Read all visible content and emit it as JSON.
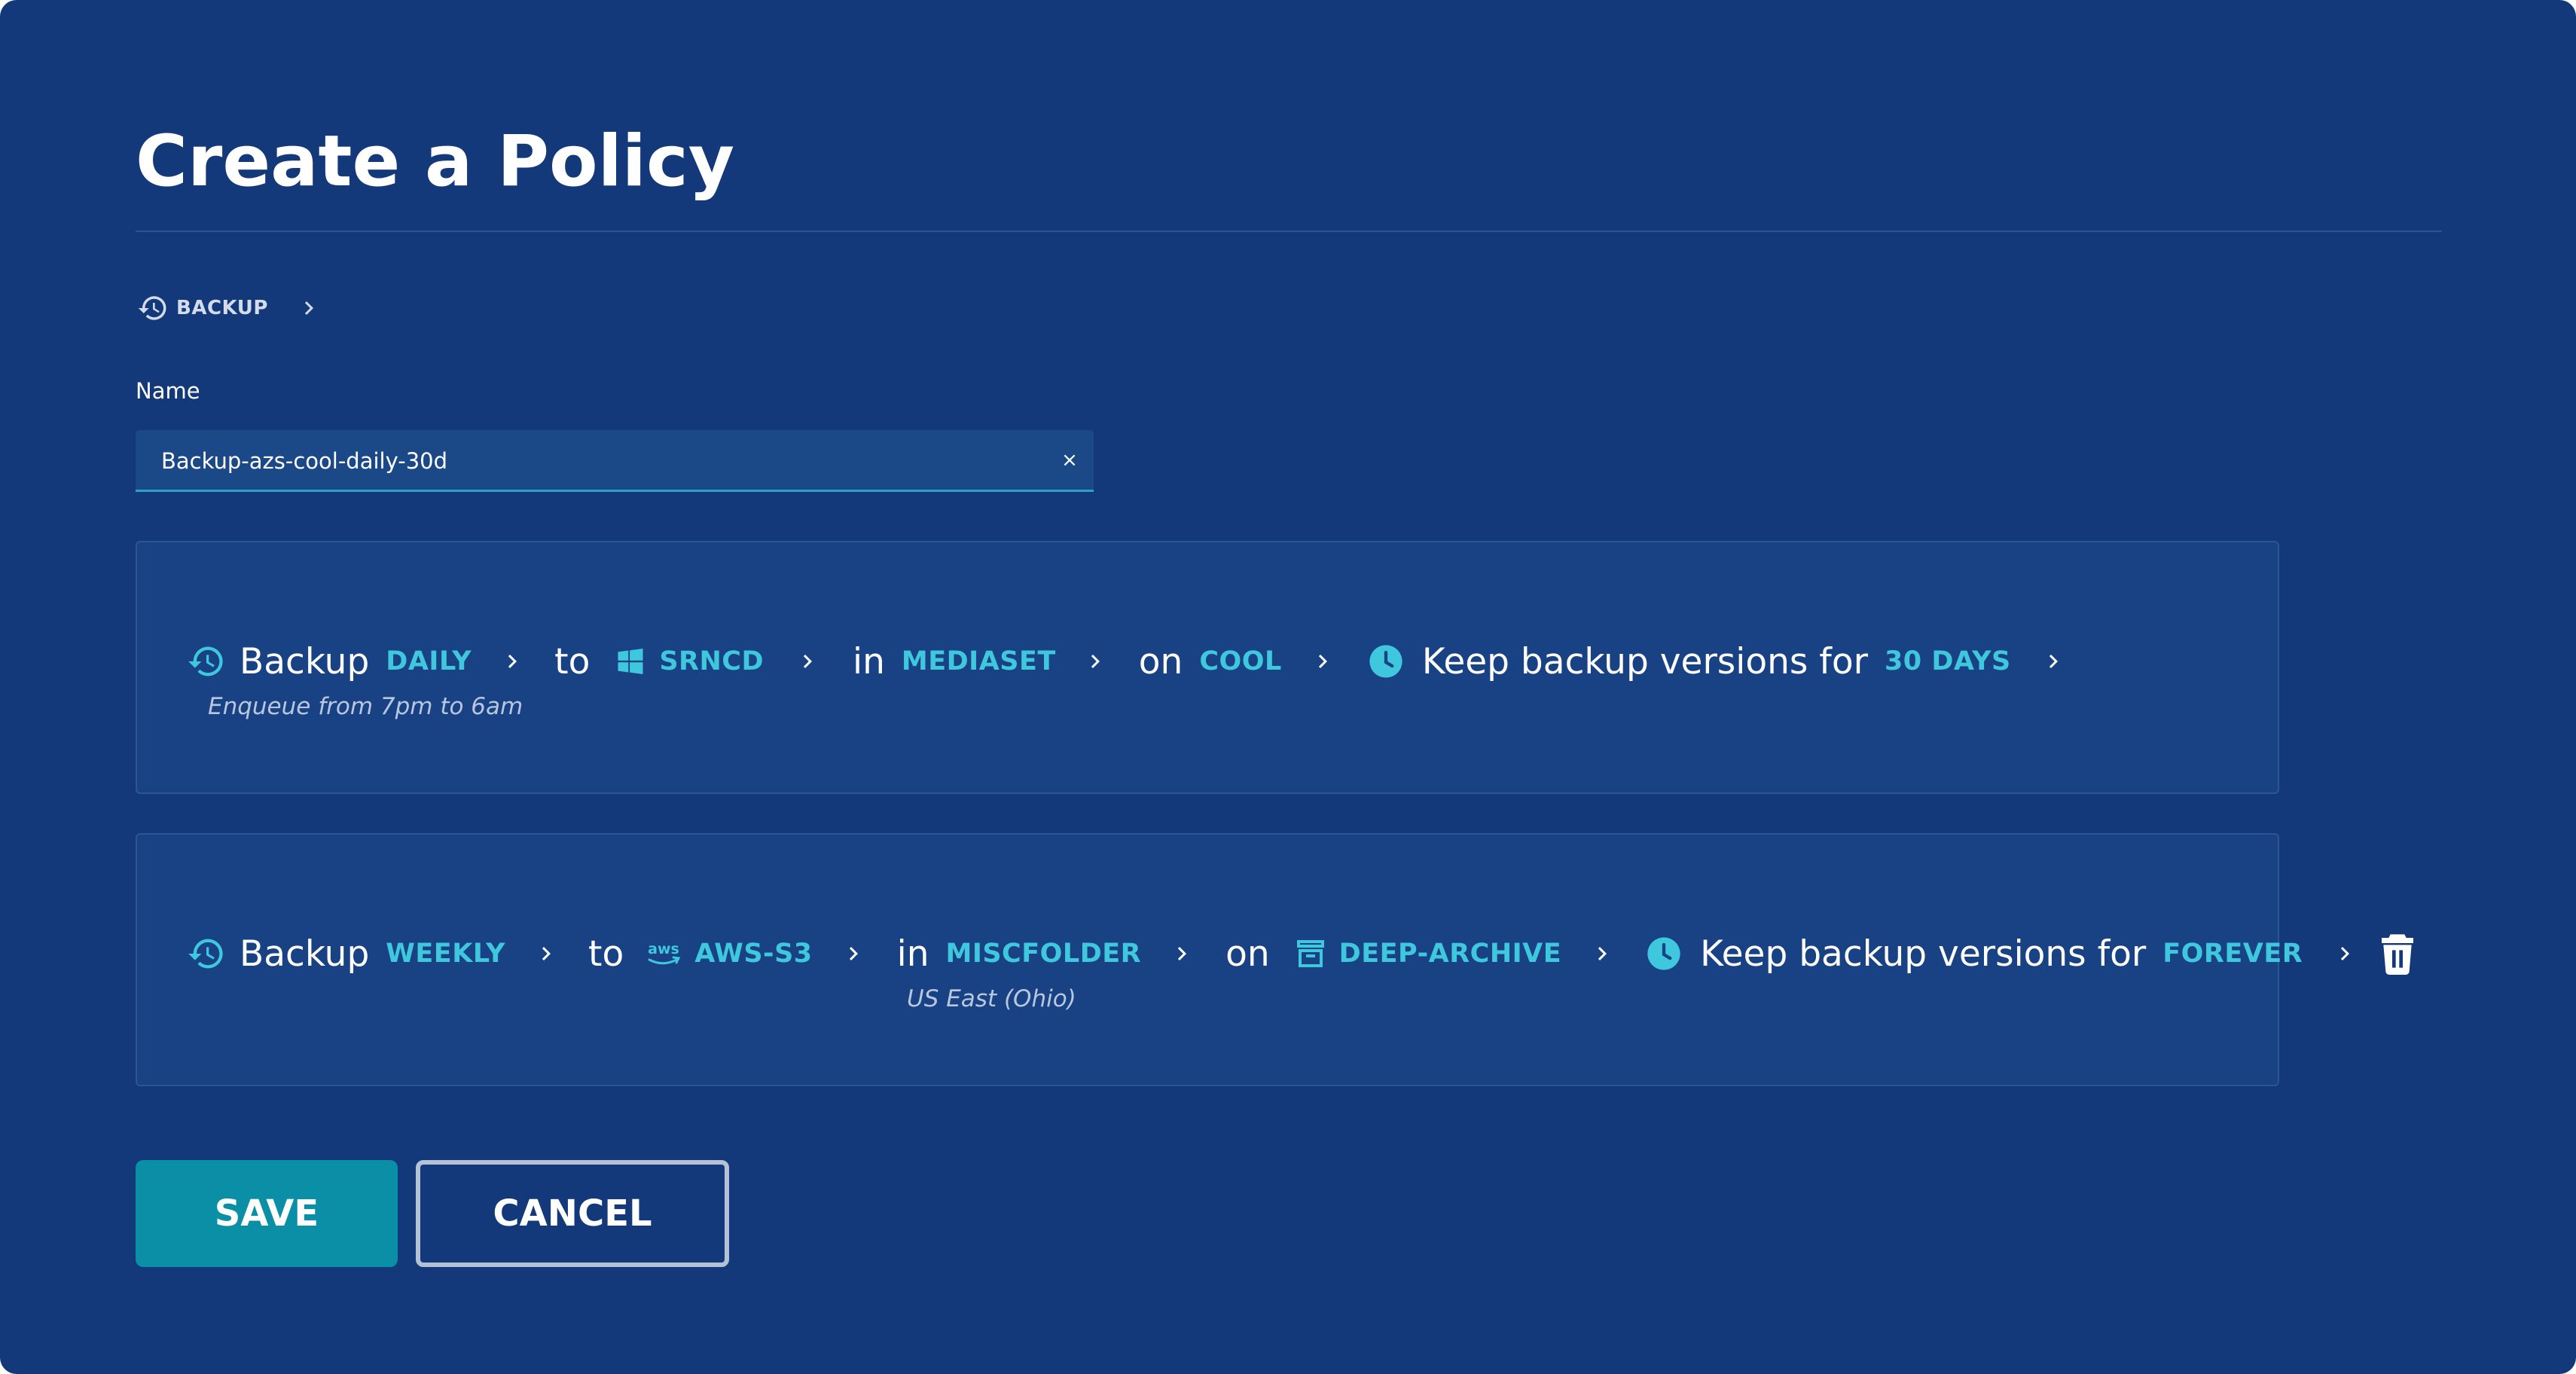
{
  "title": "Create a Policy",
  "breadcrumb": {
    "label": "BACKUP"
  },
  "name_field": {
    "label": "Name",
    "value": "Backup-azs-cool-daily-30d",
    "clear": "×"
  },
  "policies": [
    {
      "word_backup": "Backup",
      "frequency": "DAILY",
      "word_to": "to",
      "destination": "SRNCD",
      "destination_icon": "windows-icon",
      "word_in": "in",
      "folder": "MEDIASET",
      "word_on": "on",
      "tier": "COOL",
      "keep_label": "Keep backup versions for",
      "retention": "30 DAYS",
      "schedule_note": "Enqueue from 7pm to 6am"
    },
    {
      "word_backup": "Backup",
      "frequency": "WEEKLY",
      "word_to": "to",
      "destination": "AWS-S3",
      "destination_icon": "aws-icon",
      "word_in": "in",
      "folder": "MISCFOLDER",
      "word_on": "on",
      "tier": "DEEP-ARCHIVE",
      "tier_icon": "archive-box-icon",
      "keep_label": "Keep backup versions for",
      "retention": "FOREVER",
      "region_note": "US East (Ohio)"
    }
  ],
  "actions": {
    "save": "SAVE",
    "cancel": "CANCEL"
  },
  "colors": {
    "background": "#13397b",
    "card": "#184283",
    "accent": "#3fc8dd",
    "save_button": "#0a8fa6"
  }
}
